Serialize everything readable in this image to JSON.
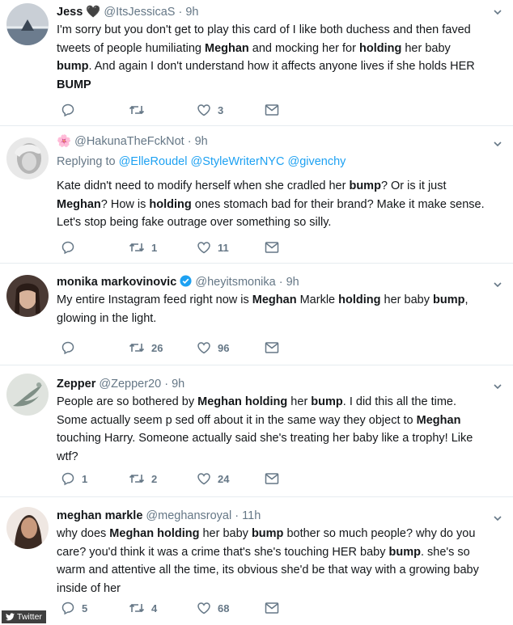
{
  "tweets": [
    {
      "name": "Jess",
      "name_suffix": "🖤",
      "handle": "@ItsJessicaS",
      "time": "9h",
      "reply_prefix": "",
      "reply_handles": [],
      "text_segments": [
        {
          "t": "I'm sorry but you don't get to play this card of I like both duchess and then faved tweets of people humiliating ",
          "b": false
        },
        {
          "t": "Meghan",
          "b": true
        },
        {
          "t": " and mocking her for ",
          "b": false
        },
        {
          "t": "holding",
          "b": true
        },
        {
          "t": " her baby ",
          "b": false
        },
        {
          "t": "bump",
          "b": true
        },
        {
          "t": ". And again I don't understand how it affects anyone lives if she holds HER ",
          "b": false
        },
        {
          "t": "BUMP",
          "b": true
        }
      ],
      "replies": "",
      "retweets": "",
      "likes": "3"
    },
    {
      "name": "",
      "name_suffix": "🌸",
      "handle": "@HakunaTheFckNot",
      "time": "9h",
      "reply_prefix": "Replying to",
      "reply_handles": [
        "@ElleRoudel",
        "@StyleWriterNYC",
        "@givenchy"
      ],
      "text_segments": [
        {
          "t": "Kate didn't need to modify herself when she cradled her ",
          "b": false
        },
        {
          "t": "bump",
          "b": true
        },
        {
          "t": "? Or is it just ",
          "b": false
        },
        {
          "t": "Meghan",
          "b": true
        },
        {
          "t": "? How is ",
          "b": false
        },
        {
          "t": "holding",
          "b": true
        },
        {
          "t": " ones stomach bad for their brand? Make it make sense. Let's stop being fake outrage over something so silly.",
          "b": false
        }
      ],
      "replies": "",
      "retweets": "1",
      "likes": "11"
    },
    {
      "name": "monika markovinovic",
      "name_suffix": "",
      "verified": true,
      "handle": "@heyitsmonika",
      "time": "9h",
      "reply_prefix": "",
      "reply_handles": [],
      "text_segments": [
        {
          "t": "My entire Instagram feed right now is ",
          "b": false
        },
        {
          "t": "Meghan",
          "b": true
        },
        {
          "t": " Markle ",
          "b": false
        },
        {
          "t": "holding",
          "b": true
        },
        {
          "t": " her baby ",
          "b": false
        },
        {
          "t": "bump",
          "b": true
        },
        {
          "t": ", glowing in the light.",
          "b": false
        }
      ],
      "replies": "",
      "retweets": "26",
      "likes": "96"
    },
    {
      "name": "Zepper",
      "name_suffix": "",
      "handle": "@Zepper20",
      "time": "9h",
      "reply_prefix": "",
      "reply_handles": [],
      "text_segments": [
        {
          "t": "People are so bothered by ",
          "b": false
        },
        {
          "t": "Meghan holding",
          "b": true
        },
        {
          "t": " her ",
          "b": false
        },
        {
          "t": "bump",
          "b": true
        },
        {
          "t": ". I did this all the time. Some actually seem p   sed off about it in the same way they object to ",
          "b": false
        },
        {
          "t": "Meghan",
          "b": true
        },
        {
          "t": " touching Harry. Someone actually said she's treating her baby like a trophy! Like wtf?",
          "b": false
        }
      ],
      "replies": "1",
      "retweets": "2",
      "likes": "24"
    },
    {
      "name": "meghan markle",
      "name_suffix": "",
      "handle": "@meghansroyal",
      "time": "11h",
      "reply_prefix": "",
      "reply_handles": [],
      "text_segments": [
        {
          "t": "why does ",
          "b": false
        },
        {
          "t": "Meghan holding",
          "b": true
        },
        {
          "t": " her baby ",
          "b": false
        },
        {
          "t": "bump",
          "b": true
        },
        {
          "t": " bother so much people? why do you care? you'd think it was a crime that's she's touching HER baby ",
          "b": false
        },
        {
          "t": "bump",
          "b": true
        },
        {
          "t": ". she's so warm and attentive all the time, its obvious she'd be that way with a growing baby inside of her",
          "b": false
        }
      ],
      "replies": "5",
      "retweets": "4",
      "likes": "68"
    }
  ],
  "credit": {
    "label": "Twitter"
  },
  "icons": {
    "reply": "reply-icon",
    "retweet": "retweet-icon",
    "like": "heart-icon",
    "dm": "envelope-icon",
    "caret": "chevron-down-icon",
    "verified": "verified-badge-icon",
    "credit_bird": "twitter-bird-icon"
  },
  "colors": {
    "link": "#1da1f2",
    "muted": "#657786",
    "text": "#14171a",
    "divider": "#e6ecf0"
  }
}
